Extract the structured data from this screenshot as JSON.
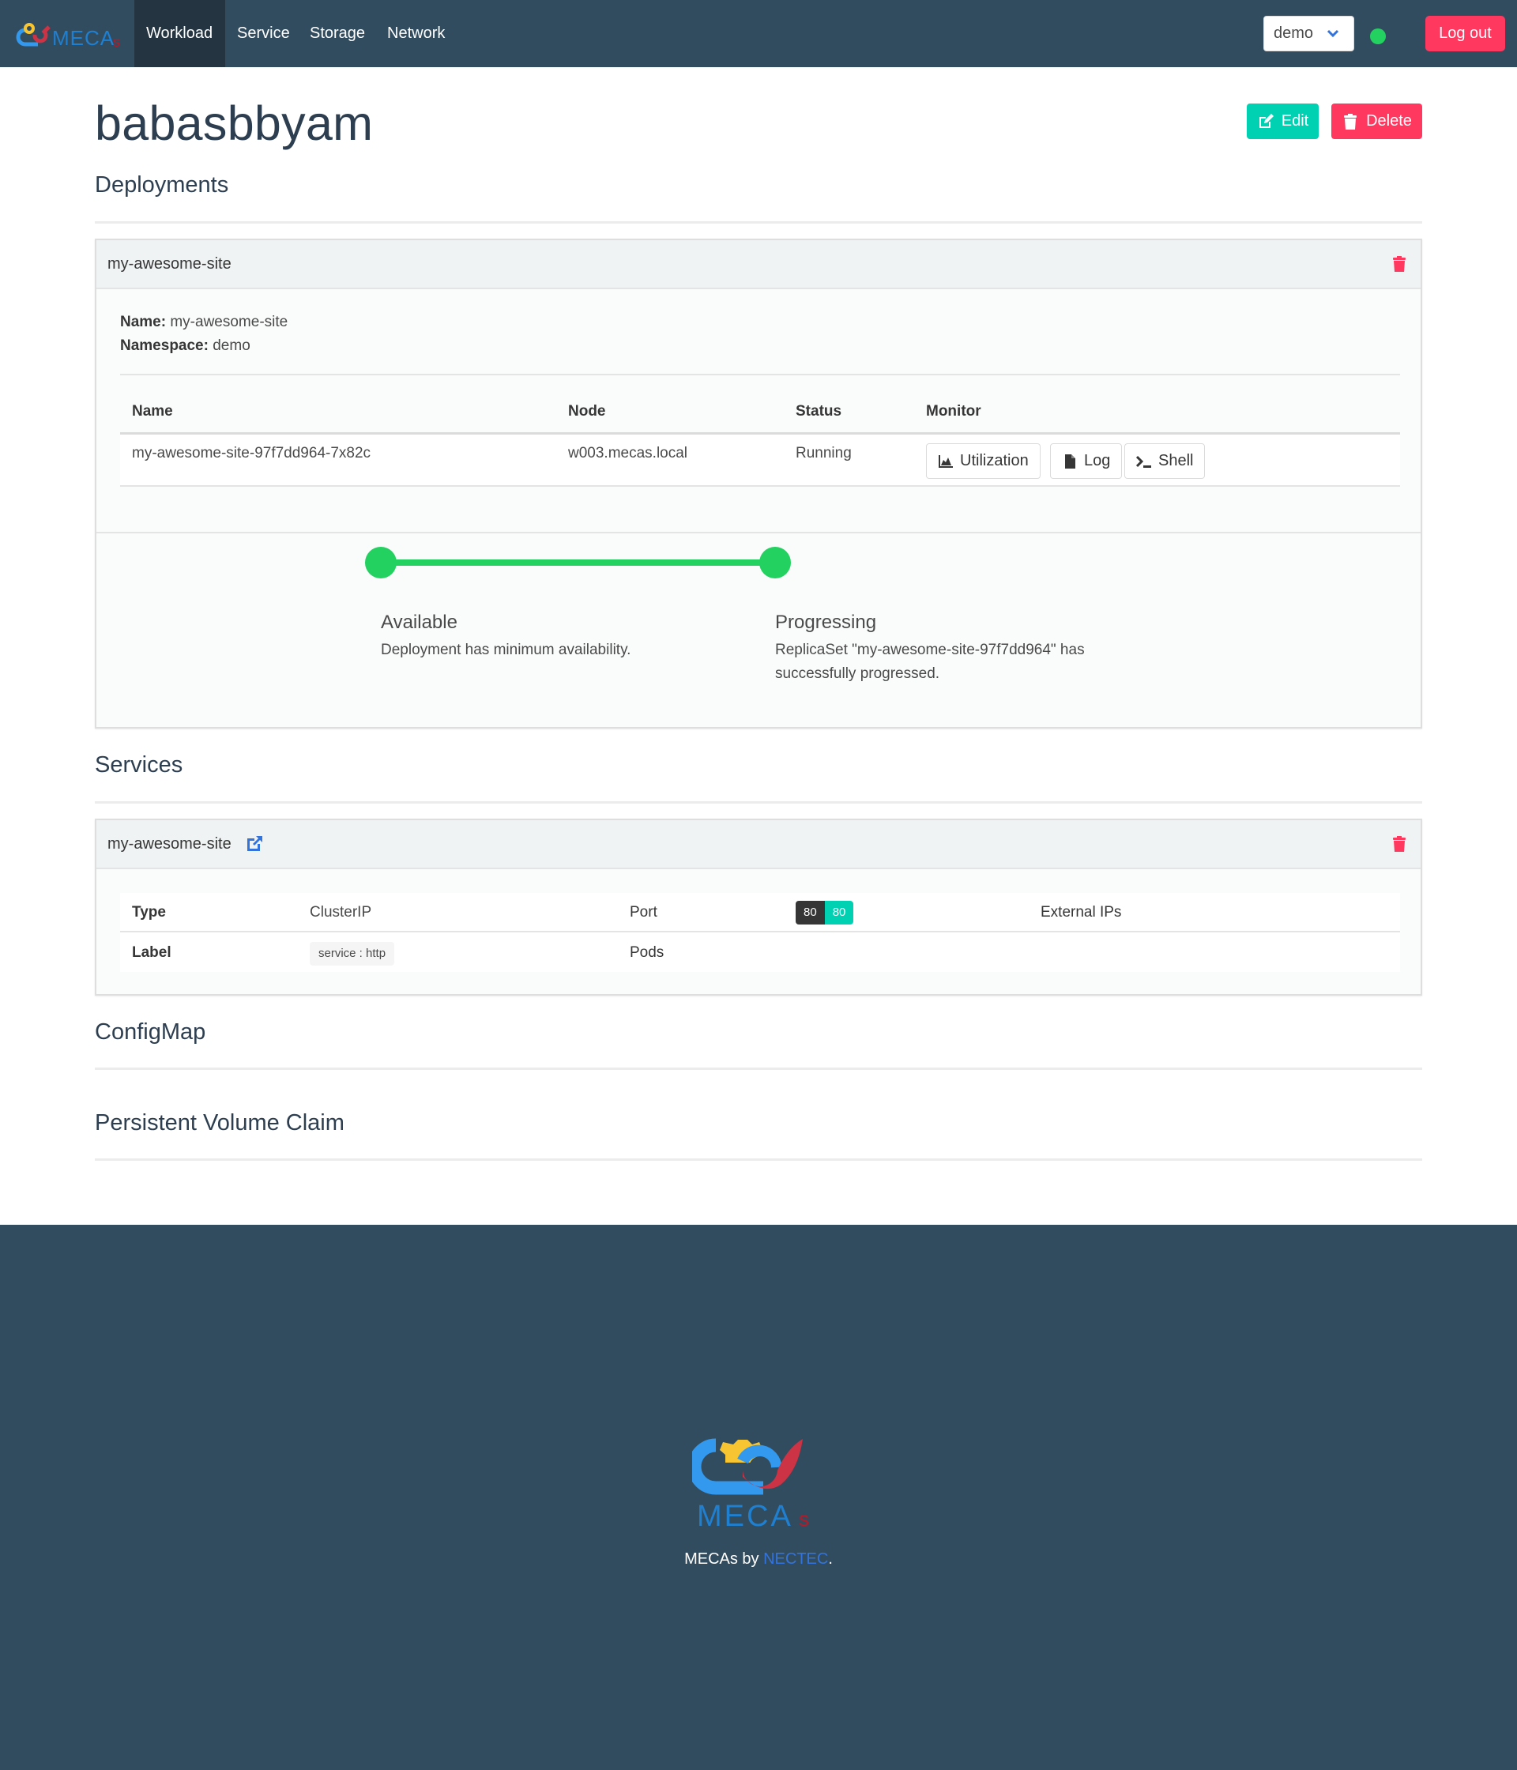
{
  "colors": {
    "navbar_bg": "#324c5f",
    "nav_active_bg": "#243441",
    "success_green": "#23d160",
    "danger": "#ff3860",
    "primary_teal": "#00d1b2",
    "link_blue": "#3273dc",
    "dark_tag": "#363636",
    "footer_bg": "#324c5f"
  },
  "navbar": {
    "brand": "MECAs",
    "items": [
      {
        "label": "Workload",
        "active": true
      },
      {
        "label": "Service",
        "active": false
      },
      {
        "label": "Storage",
        "active": false
      },
      {
        "label": "Network",
        "active": false
      }
    ],
    "namespace_select": {
      "value": "demo"
    },
    "status_icon": "online-dot-icon",
    "logout_label": "Log out"
  },
  "page": {
    "title": "babasbbyam",
    "edit_label": "Edit",
    "delete_label": "Delete"
  },
  "sections": {
    "deployments": "Deployments",
    "services": "Services",
    "configmap": "ConfigMap",
    "pvc": "Persistent Volume Claim"
  },
  "deployment": {
    "header_name": "my-awesome-site",
    "name_label": "Name:",
    "name_value": "my-awesome-site",
    "namespace_label": "Namespace:",
    "namespace_value": "demo",
    "pod_table": {
      "headers": [
        "Name",
        "Node",
        "Status",
        "Monitor"
      ],
      "rows": [
        {
          "name": "my-awesome-site-97f7dd964-7x82c",
          "node": "w003.mecas.local",
          "status": "Running",
          "monitor": [
            {
              "label": "Utilization",
              "icon": "area-chart-icon"
            },
            {
              "label": "Log",
              "icon": "file-icon"
            },
            {
              "label": "Shell",
              "icon": "terminal-icon"
            }
          ]
        }
      ]
    },
    "conditions": [
      {
        "title": "Available",
        "description": "Deployment has minimum availability.",
        "status": "ok"
      },
      {
        "title": "Progressing",
        "description": "ReplicaSet \"my-awesome-site-97f7dd964\" has successfully progressed.",
        "status": "ok"
      }
    ]
  },
  "service": {
    "header_name": "my-awesome-site",
    "type_label": "Type",
    "type_value": "ClusterIP",
    "port_label": "Port",
    "port": {
      "port": "80",
      "target_port": "80"
    },
    "external_ips_label": "External IPs",
    "external_ips_value": "",
    "label_label": "Label",
    "labels": [
      "service : http"
    ],
    "pods_label": "Pods",
    "pods_value": ""
  },
  "footer": {
    "text_prefix": "MECAs by ",
    "link_text": "NECTEC",
    "text_suffix": "."
  }
}
